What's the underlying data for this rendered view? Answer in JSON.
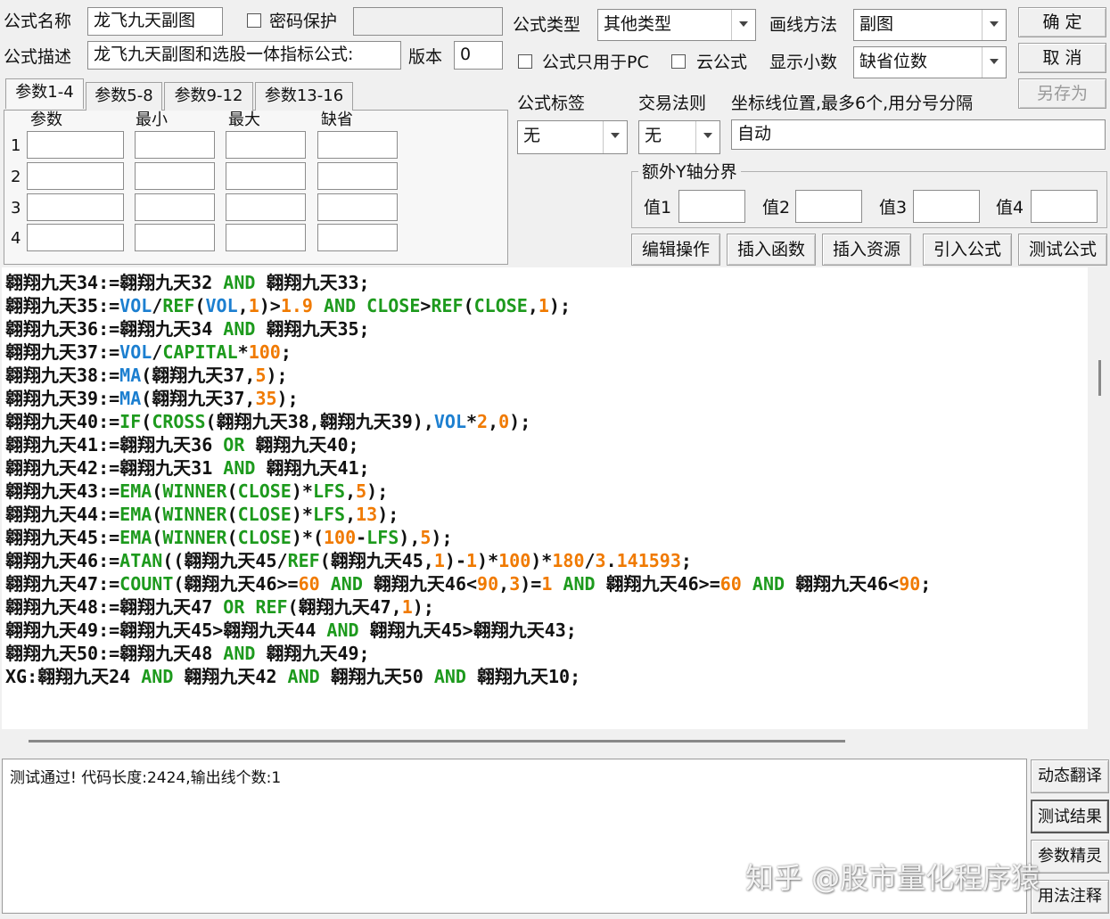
{
  "top": {
    "name_label": "公式名称",
    "name_value": "龙飞九天副图",
    "password_label": "密码保护",
    "desc_label": "公式描述",
    "desc_value": "龙飞九天副图和选股一体指标公式:",
    "version_label": "版本",
    "version_value": "0",
    "type_label": "公式类型",
    "type_value": "其他类型",
    "draw_label": "画线方法",
    "draw_value": "副图",
    "pc_only_label": "公式只用于PC",
    "cloud_label": "云公式",
    "decimals_label": "显示小数",
    "decimals_value": "缺省位数"
  },
  "buttons": {
    "ok": "确  定",
    "cancel": "取  消",
    "save_as": "另存为",
    "edit_ops": "编辑操作",
    "insert_func": "插入函数",
    "insert_res": "插入资源",
    "import_formula": "引入公式",
    "test_formula": "测试公式"
  },
  "params": {
    "tabs": [
      "参数1-4",
      "参数5-8",
      "参数9-12",
      "参数13-16"
    ],
    "headers": [
      "参数",
      "最小",
      "最大",
      "缺省"
    ],
    "rows": [
      "1",
      "2",
      "3",
      "4"
    ]
  },
  "right_mid": {
    "tag_label": "公式标签",
    "tag_value": "无",
    "rule_label": "交易法则",
    "rule_value": "无",
    "coord_label": "坐标线位置,最多6个,用分号分隔",
    "coord_value": "自动",
    "yaxis_title": "额外Y轴分界",
    "v1": "值1",
    "v2": "值2",
    "v3": "值3",
    "v4": "值4"
  },
  "code_lines": [
    [
      [
        "翱翔九天34:=翱翔九天32 ",
        "blk"
      ],
      [
        "AND",
        "kw"
      ],
      [
        " 翱翔九天33;",
        "blk"
      ]
    ],
    [
      [
        "翱翔九天35:=",
        "blk"
      ],
      [
        "VOL",
        "fn"
      ],
      [
        "/",
        "blk"
      ],
      [
        "REF",
        "kw"
      ],
      [
        "(",
        "blk"
      ],
      [
        "VOL",
        "fn"
      ],
      [
        ",",
        "blk"
      ],
      [
        "1",
        "num"
      ],
      [
        ")>",
        "blk"
      ],
      [
        "1.9",
        "num"
      ],
      [
        " ",
        "blk"
      ],
      [
        "AND",
        "kw"
      ],
      [
        " ",
        "blk"
      ],
      [
        "CLOSE",
        "kw"
      ],
      [
        ">",
        "blk"
      ],
      [
        "REF",
        "kw"
      ],
      [
        "(",
        "blk"
      ],
      [
        "CLOSE",
        "kw"
      ],
      [
        ",",
        "blk"
      ],
      [
        "1",
        "num"
      ],
      [
        ");",
        "blk"
      ]
    ],
    [
      [
        "翱翔九天36:=翱翔九天34 ",
        "blk"
      ],
      [
        "AND",
        "kw"
      ],
      [
        " 翱翔九天35;",
        "blk"
      ]
    ],
    [
      [
        "翱翔九天37:=",
        "blk"
      ],
      [
        "VOL",
        "fn"
      ],
      [
        "/",
        "blk"
      ],
      [
        "CAPITAL",
        "kw"
      ],
      [
        "*",
        "blk"
      ],
      [
        "100",
        "num"
      ],
      [
        ";",
        "blk"
      ]
    ],
    [
      [
        "翱翔九天38:=",
        "blk"
      ],
      [
        "MA",
        "fn"
      ],
      [
        "(翱翔九天37,",
        "blk"
      ],
      [
        "5",
        "num"
      ],
      [
        ");",
        "blk"
      ]
    ],
    [
      [
        "翱翔九天39:=",
        "blk"
      ],
      [
        "MA",
        "fn"
      ],
      [
        "(翱翔九天37,",
        "blk"
      ],
      [
        "35",
        "num"
      ],
      [
        ");",
        "blk"
      ]
    ],
    [
      [
        "翱翔九天40:=",
        "blk"
      ],
      [
        "IF",
        "kw"
      ],
      [
        "(",
        "blk"
      ],
      [
        "CROSS",
        "kw"
      ],
      [
        "(翱翔九天38,翱翔九天39),",
        "blk"
      ],
      [
        "VOL",
        "fn"
      ],
      [
        "*",
        "blk"
      ],
      [
        "2",
        "num"
      ],
      [
        ",",
        "blk"
      ],
      [
        "0",
        "num"
      ],
      [
        ");",
        "blk"
      ]
    ],
    [
      [
        "翱翔九天41:=翱翔九天36 ",
        "blk"
      ],
      [
        "OR",
        "kw"
      ],
      [
        " 翱翔九天40;",
        "blk"
      ]
    ],
    [
      [
        "翱翔九天42:=翱翔九天31 ",
        "blk"
      ],
      [
        "AND",
        "kw"
      ],
      [
        " 翱翔九天41;",
        "blk"
      ]
    ],
    [
      [
        "翱翔九天43:=",
        "blk"
      ],
      [
        "EMA",
        "kw"
      ],
      [
        "(",
        "blk"
      ],
      [
        "WINNER",
        "kw"
      ],
      [
        "(",
        "blk"
      ],
      [
        "CLOSE",
        "kw"
      ],
      [
        ")*",
        "blk"
      ],
      [
        "LFS",
        "kw"
      ],
      [
        ",",
        "blk"
      ],
      [
        "5",
        "num"
      ],
      [
        ");",
        "blk"
      ]
    ],
    [
      [
        "翱翔九天44:=",
        "blk"
      ],
      [
        "EMA",
        "kw"
      ],
      [
        "(",
        "blk"
      ],
      [
        "WINNER",
        "kw"
      ],
      [
        "(",
        "blk"
      ],
      [
        "CLOSE",
        "kw"
      ],
      [
        ")*",
        "blk"
      ],
      [
        "LFS",
        "kw"
      ],
      [
        ",",
        "blk"
      ],
      [
        "13",
        "num"
      ],
      [
        ");",
        "blk"
      ]
    ],
    [
      [
        "翱翔九天45:=",
        "blk"
      ],
      [
        "EMA",
        "kw"
      ],
      [
        "(",
        "blk"
      ],
      [
        "WINNER",
        "kw"
      ],
      [
        "(",
        "blk"
      ],
      [
        "CLOSE",
        "kw"
      ],
      [
        ")*(",
        "blk"
      ],
      [
        "100",
        "num"
      ],
      [
        "-",
        "blk"
      ],
      [
        "LFS",
        "kw"
      ],
      [
        "),",
        "blk"
      ],
      [
        "5",
        "num"
      ],
      [
        ");",
        "blk"
      ]
    ],
    [
      [
        "翱翔九天46:=",
        "blk"
      ],
      [
        "ATAN",
        "kw"
      ],
      [
        "((翱翔九天45/",
        "blk"
      ],
      [
        "REF",
        "kw"
      ],
      [
        "(翱翔九天45,",
        "blk"
      ],
      [
        "1",
        "num"
      ],
      [
        ")-",
        "blk"
      ],
      [
        "1",
        "num"
      ],
      [
        ")*",
        "blk"
      ],
      [
        "100",
        "num"
      ],
      [
        ")*",
        "blk"
      ],
      [
        "180",
        "num"
      ],
      [
        "/",
        "blk"
      ],
      [
        "3",
        "num"
      ],
      [
        ".",
        "blk"
      ],
      [
        "141593",
        "num"
      ],
      [
        ";",
        "blk"
      ]
    ],
    [
      [
        "翱翔九天47:=",
        "blk"
      ],
      [
        "COUNT",
        "kw"
      ],
      [
        "(翱翔九天46>=",
        "blk"
      ],
      [
        "60",
        "num"
      ],
      [
        " ",
        "blk"
      ],
      [
        "AND",
        "kw"
      ],
      [
        " 翱翔九天46<",
        "blk"
      ],
      [
        "90",
        "num"
      ],
      [
        ",",
        "blk"
      ],
      [
        "3",
        "num"
      ],
      [
        ")=",
        "blk"
      ],
      [
        "1",
        "num"
      ],
      [
        " ",
        "blk"
      ],
      [
        "AND",
        "kw"
      ],
      [
        " 翱翔九天46>=",
        "blk"
      ],
      [
        "60",
        "num"
      ],
      [
        " ",
        "blk"
      ],
      [
        "AND",
        "kw"
      ],
      [
        " 翱翔九天46<",
        "blk"
      ],
      [
        "90",
        "num"
      ],
      [
        ";",
        "blk"
      ]
    ],
    [
      [
        "翱翔九天48:=翱翔九天47 ",
        "blk"
      ],
      [
        "OR",
        "kw"
      ],
      [
        " ",
        "blk"
      ],
      [
        "REF",
        "kw"
      ],
      [
        "(翱翔九天47,",
        "blk"
      ],
      [
        "1",
        "num"
      ],
      [
        ");",
        "blk"
      ]
    ],
    [
      [
        "翱翔九天49:=翱翔九天45>翱翔九天44 ",
        "blk"
      ],
      [
        "AND",
        "kw"
      ],
      [
        " 翱翔九天45>翱翔九天43;",
        "blk"
      ]
    ],
    [
      [
        "翱翔九天50:=翱翔九天48 ",
        "blk"
      ],
      [
        "AND",
        "kw"
      ],
      [
        " 翱翔九天49;",
        "blk"
      ]
    ],
    [
      [
        "XG:翱翔九天24 ",
        "blk"
      ],
      [
        "AND",
        "kw"
      ],
      [
        " 翱翔九天42 ",
        "blk"
      ],
      [
        "AND",
        "kw"
      ],
      [
        " 翱翔九天50 ",
        "blk"
      ],
      [
        "AND",
        "kw"
      ],
      [
        " 翱翔九天10;",
        "blk"
      ]
    ]
  ],
  "output_text": "测试通过! 代码长度:2424,输出线个数:1",
  "side_buttons": [
    "动态翻译",
    "测试结果",
    "参数精灵",
    "用法注释"
  ],
  "watermark": "知乎 @股市量化程序猿",
  "colors": {
    "keyword": "#1d9a1d",
    "function": "#1c7fd0",
    "number": "#f07a00",
    "text": "#111111"
  }
}
